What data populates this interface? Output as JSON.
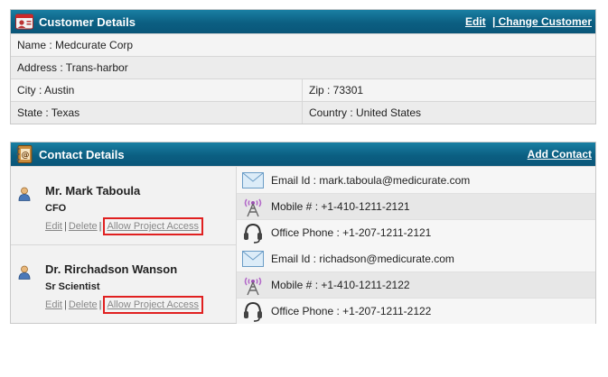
{
  "customer": {
    "title": "Customer Details",
    "edit_label": "Edit",
    "change_label": "| Change Customer",
    "name": "Name : Medcurate Corp",
    "address": "Address : Trans-harbor",
    "city": "City : Austin",
    "zip": "Zip : 73301",
    "state": "State : Texas",
    "country": "Country : United States"
  },
  "contacts": {
    "title": "Contact Details",
    "add_label": "Add Contact",
    "items": [
      {
        "name": "Mr. Mark Taboula",
        "role": "CFO",
        "edit": "Edit",
        "delete": "Delete",
        "access": "Allow Project Access",
        "email": "Email Id : mark.taboula@medicurate.com",
        "mobile": "Mobile # : +1-410-1211-2121",
        "office": "Office Phone : +1-207-1211-2121"
      },
      {
        "name": "Dr. Rirchadson Wanson",
        "role": "Sr Scientist",
        "edit": "Edit",
        "delete": "Delete",
        "access": "Allow Project Access",
        "email": "Email Id : richadson@medicurate.com",
        "mobile": "Mobile # : +1-410-1211-2122",
        "office": "Office Phone : +1-207-1211-2122"
      }
    ]
  },
  "icons": {
    "customer_header": "customer-card-icon",
    "contact_header": "address-book-icon",
    "person": "person-icon",
    "email": "envelope-icon",
    "mobile": "mobile-tower-icon",
    "office": "headset-icon"
  },
  "colors": {
    "header_bg": "#0b5f82",
    "highlight_box": "#e02020"
  }
}
